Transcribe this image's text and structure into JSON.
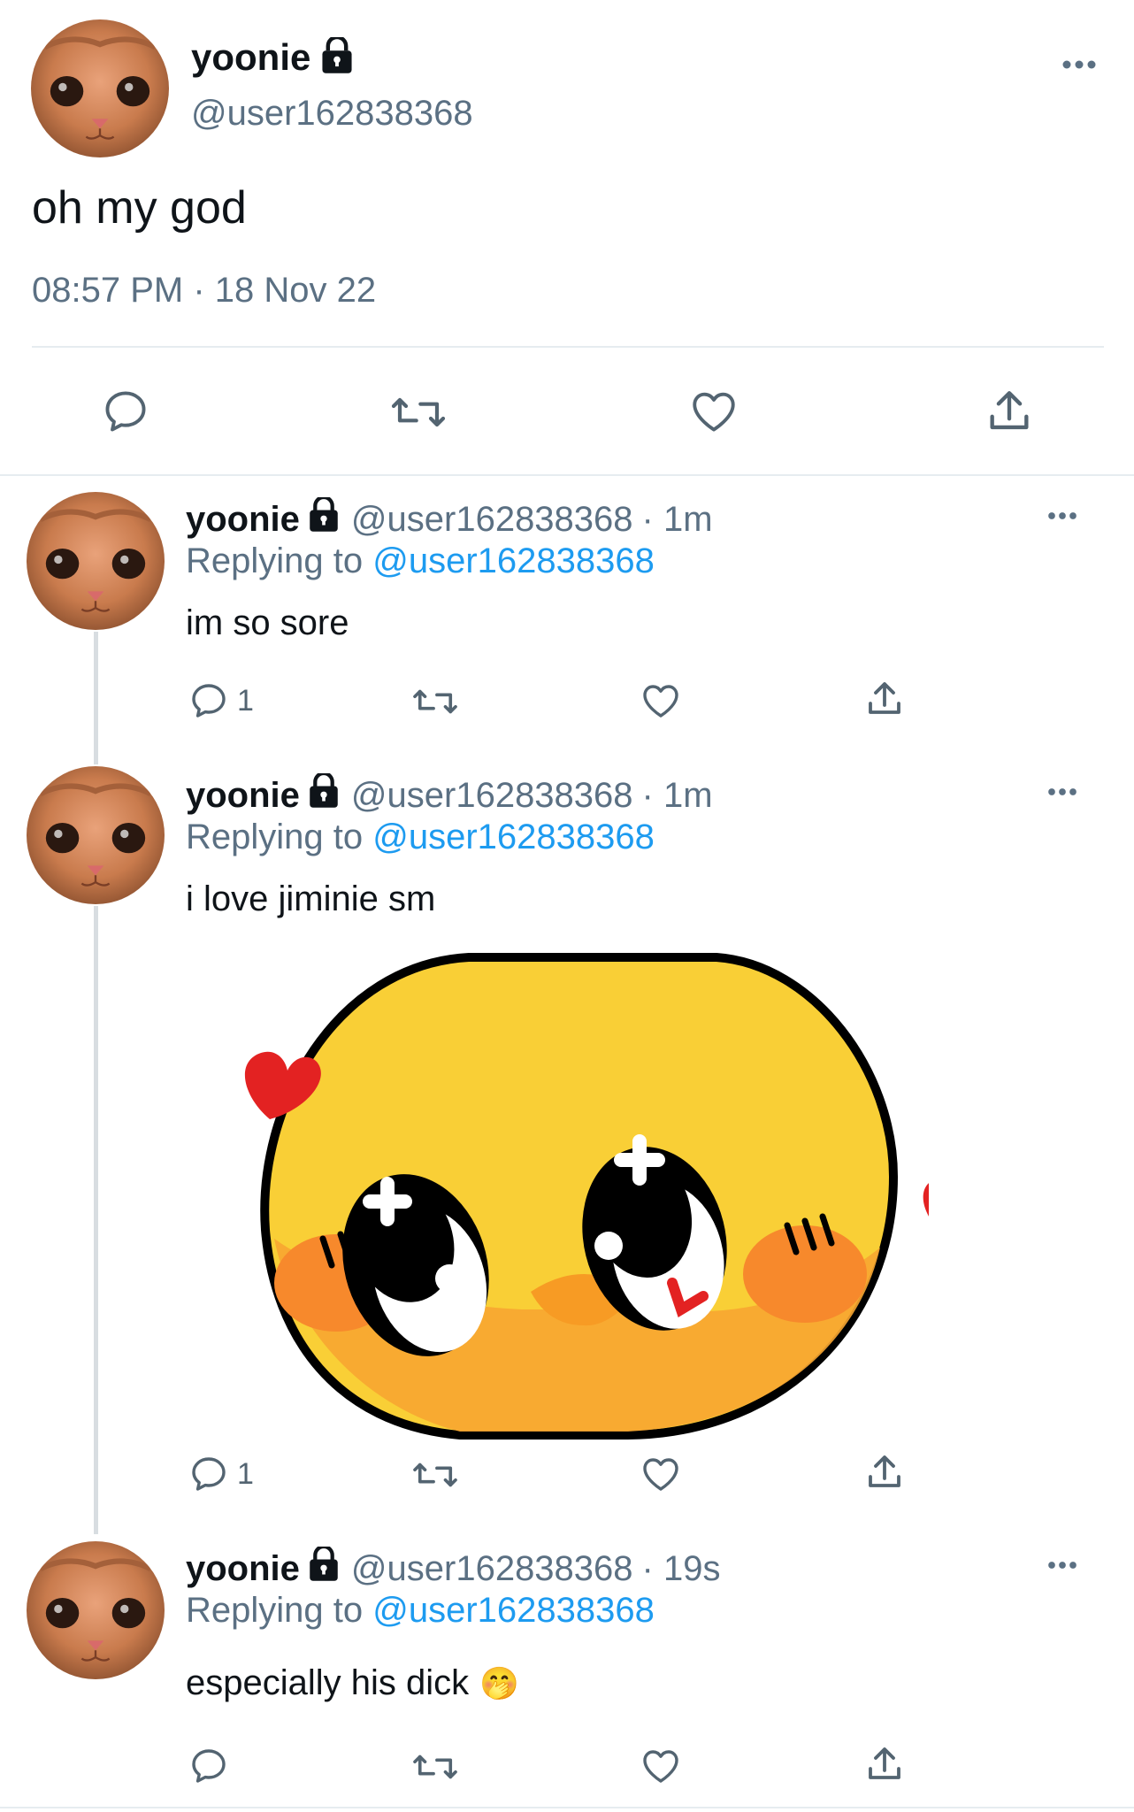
{
  "main_tweet": {
    "display_name": "yoonie",
    "handle": "@user162838368",
    "text": "oh my god",
    "timestamp": "08:57 PM · 18 Nov 22"
  },
  "replies": [
    {
      "display_name": "yoonie",
      "handle": "@user162838368",
      "time": "· 1m",
      "replying_prefix": "Replying to",
      "replying_to": "@user162838368",
      "text": "im so sore",
      "reply_count": "1"
    },
    {
      "display_name": "yoonie",
      "handle": "@user162838368",
      "time": "· 1m",
      "replying_prefix": "Replying to",
      "replying_to": "@user162838368",
      "text": "i love jiminie sm",
      "reply_count": "1",
      "media": "emoji-sticker"
    },
    {
      "display_name": "yoonie",
      "handle": "@user162838368",
      "time": "· 19s",
      "replying_prefix": "Replying to",
      "replying_to": "@user162838368",
      "text": "especially his dick",
      "emoji": "🤭",
      "reply_count": ""
    }
  ],
  "icons": {
    "more": "more-icon",
    "reply": "reply-icon",
    "retweet": "retweet-icon",
    "like": "like-icon",
    "share": "share-icon",
    "lock": "lock-icon"
  },
  "colors": {
    "link": "#1d9bf0",
    "secondary_text": "#5b7083",
    "divider": "#e6ecf0"
  }
}
